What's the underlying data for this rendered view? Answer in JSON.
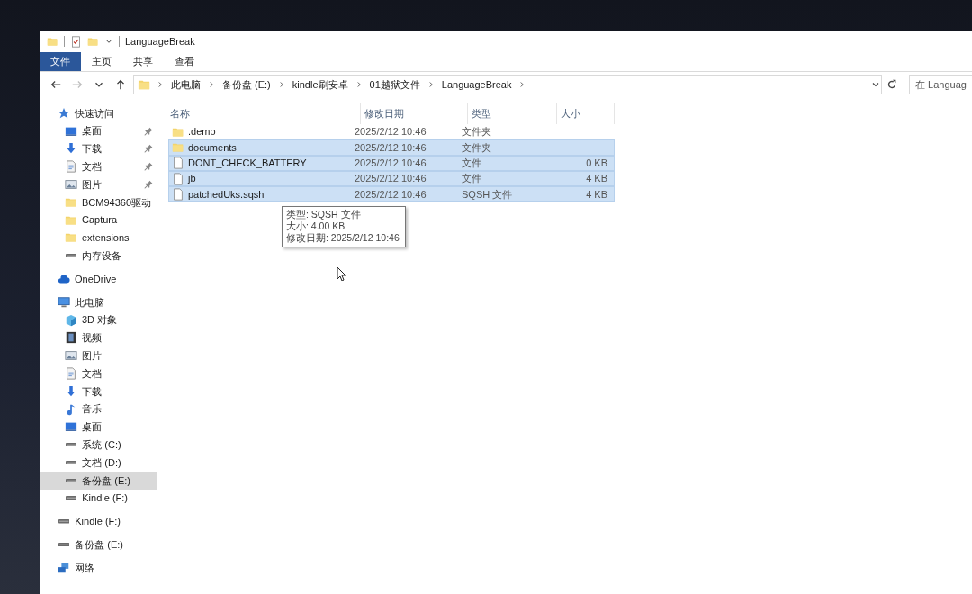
{
  "window": {
    "title": "LanguageBreak"
  },
  "ribbon_tabs": [
    {
      "label": "文件",
      "selected": true
    },
    {
      "label": "主页",
      "selected": false
    },
    {
      "label": "共享",
      "selected": false
    },
    {
      "label": "查看",
      "selected": false
    }
  ],
  "nav": {
    "back_disabled": false,
    "forward_disabled": true
  },
  "breadcrumb": [
    "此电脑",
    "备份盘 (E:)",
    "kindle刷安卓",
    "01越狱文件",
    "LanguageBreak"
  ],
  "search": {
    "placeholder": "在 Languag"
  },
  "sidebar": {
    "items": [
      {
        "label": "快速访问",
        "kind": "star",
        "selected": false,
        "children": [
          {
            "label": "桌面",
            "kind": "desktop",
            "pinned": true,
            "selected": false
          },
          {
            "label": "下载",
            "kind": "download",
            "pinned": true,
            "selected": false
          },
          {
            "label": "文档",
            "kind": "document",
            "pinned": true,
            "selected": false
          },
          {
            "label": "图片",
            "kind": "image",
            "pinned": true,
            "selected": false
          },
          {
            "label": "BCM94360驱动",
            "kind": "folder",
            "pinned": false,
            "selected": false
          },
          {
            "label": "Captura",
            "kind": "folder",
            "pinned": false,
            "selected": false
          },
          {
            "label": "extensions",
            "kind": "folder",
            "pinned": false,
            "selected": false
          },
          {
            "label": "内存设备",
            "kind": "drive",
            "pinned": false,
            "selected": false
          }
        ]
      },
      {
        "label": "OneDrive",
        "kind": "cloud",
        "selected": false
      },
      {
        "label": "此电脑",
        "kind": "computer",
        "selected": false,
        "children": [
          {
            "label": "3D 对象",
            "kind": "cube",
            "pinned": false,
            "selected": false
          },
          {
            "label": "视频",
            "kind": "film",
            "pinned": false,
            "selected": false
          },
          {
            "label": "图片",
            "kind": "image",
            "pinned": false,
            "selected": false
          },
          {
            "label": "文档",
            "kind": "document",
            "pinned": false,
            "selected": false
          },
          {
            "label": "下载",
            "kind": "download",
            "pinned": false,
            "selected": false
          },
          {
            "label": "音乐",
            "kind": "music",
            "pinned": false,
            "selected": false
          },
          {
            "label": "桌面",
            "kind": "desktop",
            "pinned": false,
            "selected": false
          },
          {
            "label": "系统 (C:)",
            "kind": "drive",
            "pinned": false,
            "selected": false
          },
          {
            "label": "文档 (D:)",
            "kind": "drive",
            "pinned": false,
            "selected": false
          },
          {
            "label": "备份盘 (E:)",
            "kind": "drive",
            "pinned": false,
            "selected": true
          },
          {
            "label": "Kindle (F:)",
            "kind": "drive",
            "pinned": false,
            "selected": false
          }
        ]
      },
      {
        "label": "Kindle (F:)",
        "kind": "drive",
        "selected": false
      },
      {
        "label": "备份盘 (E:)",
        "kind": "drive",
        "selected": false
      },
      {
        "label": "网络",
        "kind": "network",
        "selected": false
      }
    ]
  },
  "table": {
    "columns": [
      "名称",
      "修改日期",
      "类型",
      "大小"
    ],
    "rows": [
      {
        "name": ".demo",
        "kind": "folder",
        "date": "2025/2/12 10:46",
        "type": "文件夹",
        "selected": false
      },
      {
        "name": "documents",
        "kind": "folder",
        "date": "2025/2/12 10:46",
        "type": "文件夹",
        "selected": true
      },
      {
        "name": "DONT_CHECK_BATTERY",
        "kind": "file",
        "date": "2025/2/12 10:46",
        "type": "文件",
        "size": "0 KB",
        "selected": true
      },
      {
        "name": "jb",
        "kind": "file",
        "date": "2025/2/12 10:46",
        "type": "文件",
        "size": "4 KB",
        "selected": true
      },
      {
        "name": "patchedUks.sqsh",
        "kind": "file",
        "date": "2025/2/12 10:46",
        "type": "SQSH 文件",
        "size": "4 KB",
        "selected": true
      }
    ]
  },
  "tooltip": [
    "类型: SQSH 文件",
    "大小: 4.00 KB",
    "修改日期: 2025/2/12 10:46"
  ]
}
